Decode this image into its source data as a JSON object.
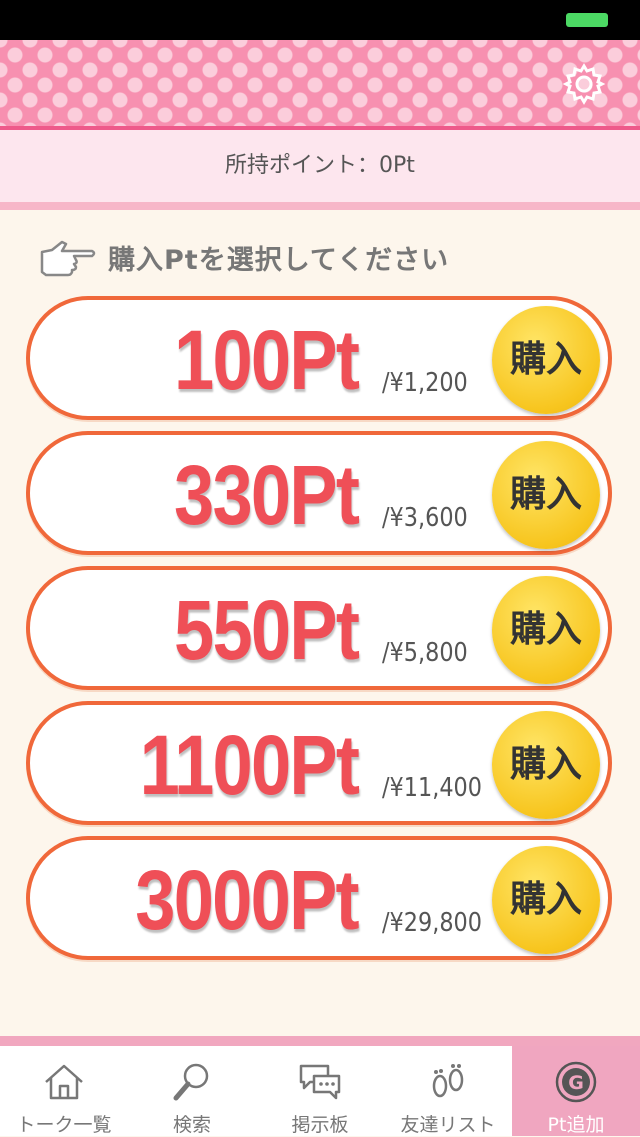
{
  "header": {
    "settings_icon": "gear-icon"
  },
  "points_bar": {
    "label": "所持ポイント：0Pt"
  },
  "prompt": {
    "icon": "pointing-hand-icon",
    "text": "購入Ptを選択してください"
  },
  "packages": [
    {
      "points": "100Pt",
      "price": "/¥1,200",
      "buy_label": "購入"
    },
    {
      "points": "330Pt",
      "price": "/¥3,600",
      "buy_label": "購入"
    },
    {
      "points": "550Pt",
      "price": "/¥5,800",
      "buy_label": "購入"
    },
    {
      "points": "1100Pt",
      "price": "/¥11,400",
      "buy_label": "購入"
    },
    {
      "points": "3000Pt",
      "price": "/¥29,800",
      "buy_label": "購入"
    }
  ],
  "tabs": [
    {
      "label": "トーク一覧",
      "icon": "home-icon"
    },
    {
      "label": "検索",
      "icon": "magnifier-icon"
    },
    {
      "label": "掲示板",
      "icon": "chat-bubbles-icon"
    },
    {
      "label": "友達リスト",
      "icon": "footprints-icon"
    },
    {
      "label": "Pt追加",
      "icon": "g-coin-icon",
      "active": true
    }
  ],
  "colors": {
    "header_pink": "#f790b0",
    "package_border": "#f0683a",
    "points_red": "#ef4f57",
    "buy_yellow": "#f7c51e",
    "active_tab": "#f0a6c0"
  }
}
